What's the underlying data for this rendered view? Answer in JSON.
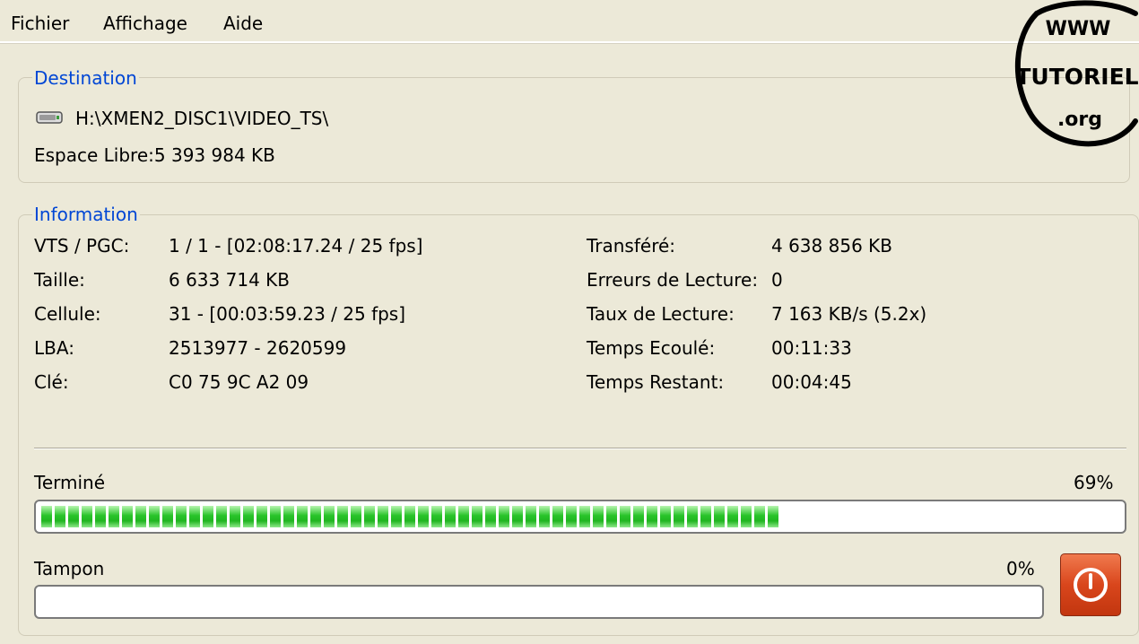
{
  "menu": {
    "items": [
      "Fichier",
      "Affichage",
      "Aide"
    ]
  },
  "destination": {
    "legend": "Destination",
    "path": "H:\\XMEN2_DISC1\\VIDEO_TS\\",
    "free_space": "Espace Libre:5 393 984 KB",
    "icon": "drive-icon"
  },
  "information": {
    "legend": "Information",
    "left": [
      {
        "label": "VTS / PGC:",
        "value": "1 / 1 - [02:08:17.24 / 25 fps]"
      },
      {
        "label": "Taille:",
        "value": "6 633 714 KB"
      },
      {
        "label": "Cellule:",
        "value": "31 - [00:03:59.23 / 25 fps]"
      },
      {
        "label": "LBA:",
        "value": "2513977 - 2620599"
      },
      {
        "label": "Clé:",
        "value": "C0 75 9C A2 09"
      }
    ],
    "right": [
      {
        "label": "Transféré:",
        "value": "4 638 856 KB"
      },
      {
        "label": "Erreurs de Lecture:",
        "value": "0"
      },
      {
        "label": "Taux de Lecture:",
        "value": "7 163 KB/s (5.2x)"
      },
      {
        "label": "Temps Ecoulé:",
        "value": "00:11:33"
      },
      {
        "label": "Temps Restant:",
        "value": "00:04:45"
      }
    ]
  },
  "progress": {
    "done_label": "Terminé",
    "done_percent_text": "69%",
    "done_fraction": 0.69,
    "buffer_label": "Tampon",
    "buffer_percent_text": "0%",
    "buffer_fraction": 0.0,
    "fill_color": "#29c42a"
  },
  "stop_button": {
    "icon": "power-icon",
    "color": "#d9461c"
  },
  "watermark": {
    "line1": "WWW",
    "line2": "TUTORIEL",
    "line3": ".org"
  }
}
